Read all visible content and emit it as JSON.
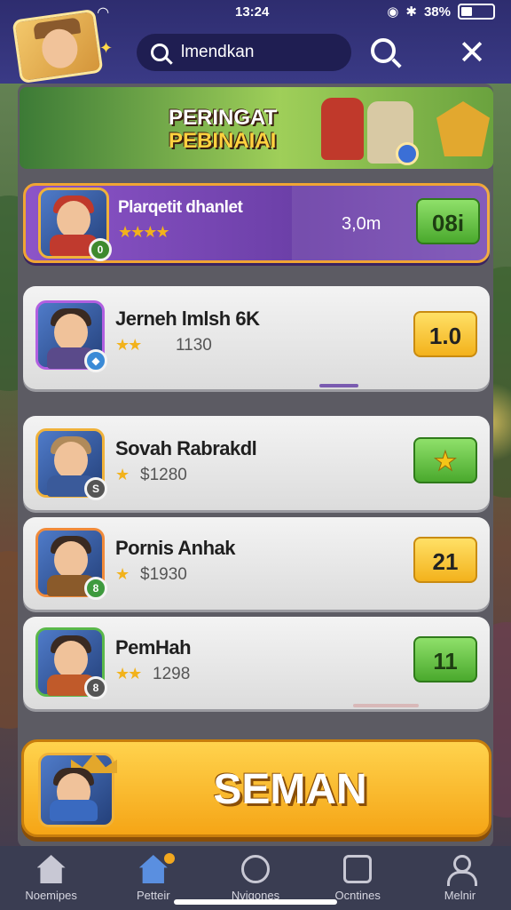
{
  "status_bar": {
    "time": "13:24",
    "battery": "38%"
  },
  "header": {
    "search_value": "lmendkan"
  },
  "banner": {
    "title_line1": "PERINGAT",
    "title_line2": "PEBINAIAI"
  },
  "leaderboard": [
    {
      "name": "Plarqetit dhanlet",
      "stars": "★★★★",
      "score": "3,0m",
      "button": "08i",
      "button_color": "green",
      "highlighted": true
    },
    {
      "name": "Jerneh lmlsh 6K",
      "stars": "★★",
      "score": "1130",
      "button": "1.0",
      "button_color": "yellow",
      "highlighted": false
    },
    {
      "name": "Sovah Rabrakdl",
      "stars": "★",
      "score": "$1280",
      "button": "★",
      "button_color": "green",
      "highlighted": false
    },
    {
      "name": "Pornis Anhak",
      "stars": "★",
      "score": "$1930",
      "button": "21",
      "button_color": "yellow",
      "highlighted": false
    },
    {
      "name": "PemHah",
      "stars": "★★",
      "score": "1298",
      "button": "11",
      "button_color": "green",
      "highlighted": false
    }
  ],
  "cta": {
    "label": "SEMAN"
  },
  "bottom_nav": [
    {
      "label": "Noemipes",
      "icon": "home-icon"
    },
    {
      "label": "Petteir",
      "icon": "home-active-icon"
    },
    {
      "label": "Nvigones",
      "icon": "clock-icon"
    },
    {
      "label": "Ocntines",
      "icon": "box-icon"
    },
    {
      "label": "Melnir",
      "icon": "person-icon"
    }
  ],
  "colors": {
    "header_bg": "#2e2d6f",
    "highlight_row": "#6b3fa7",
    "button_green": "#4aa92d",
    "button_yellow": "#f3b21c",
    "cta_bg": "#f5a516",
    "bottom_nav_bg": "#3a3d52"
  }
}
